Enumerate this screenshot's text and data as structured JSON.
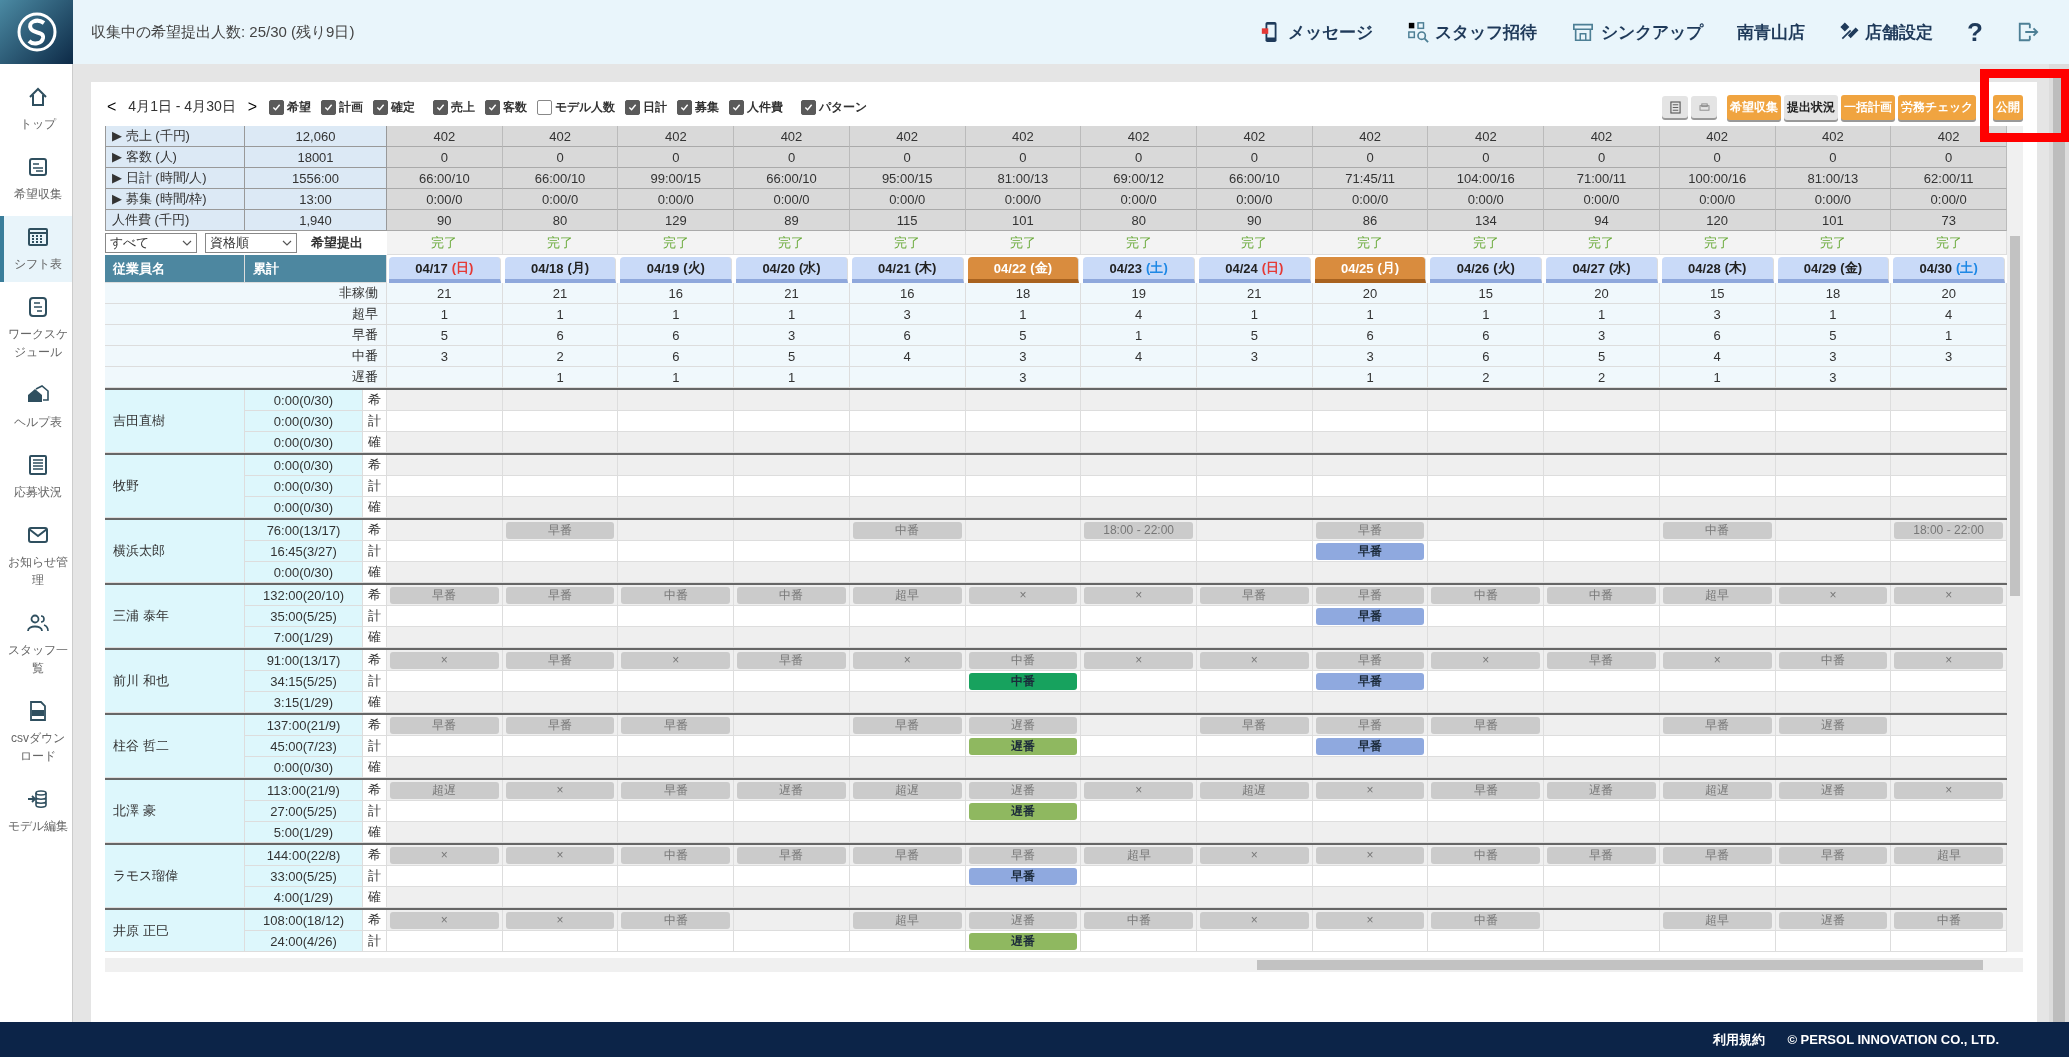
{
  "header": {
    "title": "収集中の希望提出人数: 25/30 (残り9日)",
    "nav": [
      {
        "label": "メッセージ"
      },
      {
        "label": "スタッフ招待"
      },
      {
        "label": "シンクアップ"
      }
    ],
    "store_name": "南青山店",
    "settings_label": "店舗設定",
    "help_label": "?"
  },
  "sidebar": {
    "items": [
      {
        "label": "トップ",
        "selected": false
      },
      {
        "label": "希望収集",
        "selected": false
      },
      {
        "label": "シフト表",
        "selected": true
      },
      {
        "label": "ワークスケジュール",
        "selected": false
      },
      {
        "label": "ヘルプ表",
        "selected": false
      },
      {
        "label": "応募状況",
        "selected": false
      },
      {
        "label": "お知らせ管理",
        "selected": false
      },
      {
        "label": "スタッフ一覧",
        "selected": false
      },
      {
        "label": "csvダウンロード",
        "selected": false
      },
      {
        "label": "モデル編集",
        "selected": false
      }
    ]
  },
  "toolbar": {
    "prev": "<",
    "range": "4月1日 - 4月30日",
    "next": ">",
    "checkboxes": [
      {
        "label": "希望",
        "checked": true
      },
      {
        "label": "計画",
        "checked": true
      },
      {
        "label": "確定",
        "checked": true
      },
      {
        "label": "売上",
        "checked": true
      },
      {
        "label": "客数",
        "checked": true
      },
      {
        "label": "モデル人数",
        "checked": false
      },
      {
        "label": "日計",
        "checked": true
      },
      {
        "label": "募集",
        "checked": true
      },
      {
        "label": "人件費",
        "checked": true
      },
      {
        "label": "パターン",
        "checked": true
      }
    ],
    "buttons": [
      {
        "label": "希望収集",
        "kind": "primary"
      },
      {
        "label": "提出状況",
        "kind": "secondary"
      },
      {
        "label": "一括計画",
        "kind": "primary"
      },
      {
        "label": "労務チェック",
        "kind": "primary"
      },
      {
        "label": "公開",
        "kind": "primary"
      }
    ]
  },
  "summary_rows": [
    {
      "label": "▶ 売上 (千円)",
      "total": "12,060",
      "values": [
        "402",
        "402",
        "402",
        "402",
        "402",
        "402",
        "402",
        "402",
        "402",
        "402",
        "402",
        "402",
        "402",
        "402"
      ]
    },
    {
      "label": "▶ 客数 (人)",
      "total": "18001",
      "values": [
        "0",
        "0",
        "0",
        "0",
        "0",
        "0",
        "0",
        "0",
        "0",
        "0",
        "0",
        "0",
        "0",
        "0"
      ]
    },
    {
      "label": "▶ 日計 (時間/人)",
      "total": "1556:00",
      "values": [
        "66:00/10",
        "66:00/10",
        "99:00/15",
        "66:00/10",
        "95:00/15",
        "81:00/13",
        "69:00/12",
        "66:00/10",
        "71:45/11",
        "104:00/16",
        "71:00/11",
        "100:00/16",
        "81:00/13",
        "62:00/11"
      ]
    },
    {
      "label": "▶ 募集 (時間/枠)",
      "total": "13:00",
      "values": [
        "0:00/0",
        "0:00/0",
        "0:00/0",
        "0:00/0",
        "0:00/0",
        "0:00/0",
        "0:00/0",
        "0:00/0",
        "0:00/0",
        "0:00/0",
        "0:00/0",
        "0:00/0",
        "0:00/0",
        "0:00/0"
      ]
    },
    {
      "label": "人件費 (千円)",
      "total": "1,940",
      "values": [
        "90",
        "80",
        "129",
        "89",
        "115",
        "101",
        "80",
        "90",
        "86",
        "134",
        "94",
        "120",
        "101",
        "73"
      ]
    }
  ],
  "filters": {
    "group": "すべて",
    "order": "資格順",
    "status_label": "希望提出"
  },
  "statuses": [
    "完了",
    "完了",
    "完了",
    "完了",
    "完了",
    "完了",
    "完了",
    "完了",
    "完了",
    "完了",
    "完了",
    "完了",
    "完了",
    "完了"
  ],
  "columns": {
    "name": "従業員名",
    "total": "累計"
  },
  "days": [
    {
      "date": "04/17",
      "weekday": "(日)",
      "color": "#e53935",
      "highlighted": false,
      "counts": [
        "21",
        "1",
        "5",
        "3"
      ]
    },
    {
      "date": "04/18",
      "weekday": "(月)",
      "highlighted": false,
      "counts": [
        "21",
        "1",
        "6",
        "2",
        "1"
      ]
    },
    {
      "date": "04/19",
      "weekday": "(火)",
      "highlighted": false,
      "counts": [
        "16",
        "1",
        "6",
        "6",
        "1"
      ]
    },
    {
      "date": "04/20",
      "weekday": "(水)",
      "highlighted": false,
      "counts": [
        "21",
        "1",
        "3",
        "5",
        "1"
      ]
    },
    {
      "date": "04/21",
      "weekday": "(木)",
      "highlighted": false,
      "counts": [
        "16",
        "3",
        "6",
        "4"
      ]
    },
    {
      "date": "04/22",
      "weekday": "(金)",
      "highlighted": true,
      "counts": [
        "18",
        "1",
        "5",
        "3",
        "3"
      ]
    },
    {
      "date": "04/23",
      "weekday": "(土)",
      "color": "#1e88e5",
      "highlighted": false,
      "counts": [
        "19",
        "4",
        "1",
        "4"
      ]
    },
    {
      "date": "04/24",
      "weekday": "(日)",
      "color": "#e53935",
      "highlighted": false,
      "counts": [
        "21",
        "1",
        "5",
        "3"
      ]
    },
    {
      "date": "04/25",
      "weekday": "(月)",
      "highlighted": true,
      "counts": [
        "20",
        "1",
        "6",
        "3",
        "1"
      ]
    },
    {
      "date": "04/26",
      "weekday": "(火)",
      "highlighted": false,
      "counts": [
        "15",
        "1",
        "6",
        "6",
        "2"
      ]
    },
    {
      "date": "04/27",
      "weekday": "(水)",
      "highlighted": false,
      "counts": [
        "20",
        "1",
        "3",
        "5",
        "2"
      ]
    },
    {
      "date": "04/28",
      "weekday": "(木)",
      "highlighted": false,
      "counts": [
        "15",
        "3",
        "6",
        "4",
        "1"
      ]
    },
    {
      "date": "04/29",
      "weekday": "(金)",
      "highlighted": false,
      "counts": [
        "18",
        "1",
        "5",
        "3",
        "3"
      ]
    },
    {
      "date": "04/30",
      "weekday": "(土)",
      "color": "#1e88e5",
      "highlighted": false,
      "counts": [
        "20",
        "4",
        "1",
        "3"
      ]
    }
  ],
  "count_labels": [
    "非稼働",
    "超早",
    "早番",
    "中番",
    "遅番"
  ],
  "staff": [
    {
      "name": "吉田直樹",
      "rows": [
        {
          "kind": "wish",
          "type": "希",
          "total": "0:00(0/30)",
          "cells": [
            null,
            null,
            null,
            null,
            null,
            null,
            null,
            null,
            null,
            null,
            null,
            null,
            null,
            null
          ]
        },
        {
          "kind": "plan",
          "type": "計",
          "total": "0:00(0/30)",
          "cells": [
            null,
            null,
            null,
            null,
            null,
            null,
            null,
            null,
            null,
            null,
            null,
            null,
            null,
            null
          ]
        },
        {
          "kind": "fixed",
          "type": "確",
          "total": "0:00(0/30)",
          "cells": [
            null,
            null,
            null,
            null,
            null,
            null,
            null,
            null,
            null,
            null,
            null,
            null,
            null,
            null
          ]
        }
      ]
    },
    {
      "name": "牧野",
      "rows": [
        {
          "kind": "wish",
          "type": "希",
          "total": "0:00(0/30)",
          "cells": [
            null,
            null,
            null,
            null,
            null,
            null,
            null,
            null,
            null,
            null,
            null,
            null,
            null,
            null
          ]
        },
        {
          "kind": "plan",
          "type": "計",
          "total": "0:00(0/30)",
          "cells": [
            null,
            null,
            null,
            null,
            null,
            null,
            null,
            null,
            null,
            null,
            null,
            null,
            null,
            null
          ]
        },
        {
          "kind": "fixed",
          "type": "確",
          "total": "0:00(0/30)",
          "cells": [
            null,
            null,
            null,
            null,
            null,
            null,
            null,
            null,
            null,
            null,
            null,
            null,
            null,
            null
          ]
        }
      ]
    },
    {
      "name": "横浜太郎",
      "rows": [
        {
          "kind": "wish",
          "type": "希",
          "total": "76:00(13/17)",
          "cells": [
            null,
            "早番",
            null,
            null,
            "中番",
            null,
            "18:00 - 22:00",
            null,
            "早番",
            null,
            null,
            "中番",
            null,
            "18:00 - 22:00"
          ]
        },
        {
          "kind": "plan",
          "type": "計",
          "total": "16:45(3/27)",
          "cells": [
            null,
            null,
            null,
            null,
            null,
            null,
            null,
            null,
            {
              "text": "早番",
              "color": "#8fa9df"
            },
            null,
            null,
            null,
            null,
            null
          ]
        },
        {
          "kind": "fixed",
          "type": "確",
          "total": "0:00(0/30)",
          "cells": [
            null,
            null,
            null,
            null,
            null,
            null,
            null,
            null,
            null,
            null,
            null,
            null,
            null,
            null
          ]
        }
      ]
    },
    {
      "name": "三浦 泰年",
      "rows": [
        {
          "kind": "wish",
          "type": "希",
          "total": "132:00(20/10)",
          "cells": [
            "早番",
            "早番",
            "中番",
            "中番",
            "超早",
            "×",
            "×",
            "早番",
            "早番",
            "中番",
            "中番",
            "超早",
            "×",
            "×"
          ]
        },
        {
          "kind": "plan",
          "type": "計",
          "total": "35:00(5/25)",
          "cells": [
            null,
            null,
            null,
            null,
            null,
            null,
            null,
            null,
            {
              "text": "早番",
              "color": "#8fa9df"
            },
            null,
            null,
            null,
            null,
            null
          ]
        },
        {
          "kind": "fixed",
          "type": "確",
          "total": "7:00(1/29)",
          "cells": [
            null,
            null,
            null,
            null,
            null,
            null,
            null,
            null,
            null,
            null,
            null,
            null,
            null,
            null
          ]
        }
      ]
    },
    {
      "name": "前川 和也",
      "rows": [
        {
          "kind": "wish",
          "type": "希",
          "total": "91:00(13/17)",
          "cells": [
            "×",
            "早番",
            "×",
            "早番",
            "×",
            "中番",
            "×",
            "×",
            "早番",
            "×",
            "早番",
            "×",
            "中番",
            "×"
          ]
        },
        {
          "kind": "plan",
          "type": "計",
          "total": "34:15(5/25)",
          "cells": [
            null,
            null,
            null,
            null,
            null,
            {
              "text": "中番",
              "color": "#17a25e"
            },
            null,
            null,
            {
              "text": "早番",
              "color": "#8fa9df"
            },
            null,
            null,
            null,
            null,
            null
          ]
        },
        {
          "kind": "fixed",
          "type": "確",
          "total": "3:15(1/29)",
          "cells": [
            null,
            null,
            null,
            null,
            null,
            null,
            null,
            null,
            null,
            null,
            null,
            null,
            null,
            null
          ]
        }
      ]
    },
    {
      "name": "柱谷 哲二",
      "rows": [
        {
          "kind": "wish",
          "type": "希",
          "total": "137:00(21/9)",
          "cells": [
            "早番",
            "早番",
            "早番",
            null,
            "早番",
            "遅番",
            null,
            "早番",
            "早番",
            "早番",
            null,
            "早番",
            "遅番",
            null
          ]
        },
        {
          "kind": "plan",
          "type": "計",
          "total": "45:00(7/23)",
          "cells": [
            null,
            null,
            null,
            null,
            null,
            {
              "text": "遅番",
              "color": "#8fb860"
            },
            null,
            null,
            {
              "text": "早番",
              "color": "#8fa9df"
            },
            null,
            null,
            null,
            null,
            null
          ]
        },
        {
          "kind": "fixed",
          "type": "確",
          "total": "0:00(0/30)",
          "cells": [
            null,
            null,
            null,
            null,
            null,
            null,
            null,
            null,
            null,
            null,
            null,
            null,
            null,
            null
          ]
        }
      ]
    },
    {
      "name": "北澤 豪",
      "rows": [
        {
          "kind": "wish",
          "type": "希",
          "total": "113:00(21/9)",
          "cells": [
            "超遅",
            "×",
            "早番",
            "遅番",
            "超遅",
            "遅番",
            "×",
            "超遅",
            "×",
            "早番",
            "遅番",
            "超遅",
            "遅番",
            "×"
          ]
        },
        {
          "kind": "plan",
          "type": "計",
          "total": "27:00(5/25)",
          "cells": [
            null,
            null,
            null,
            null,
            null,
            {
              "text": "遅番",
              "color": "#8fb860"
            },
            null,
            null,
            null,
            null,
            null,
            null,
            null,
            null
          ]
        },
        {
          "kind": "fixed",
          "type": "確",
          "total": "5:00(1/29)",
          "cells": [
            null,
            null,
            null,
            null,
            null,
            null,
            null,
            null,
            null,
            null,
            null,
            null,
            null,
            null
          ]
        }
      ]
    },
    {
      "name": "ラモス瑠偉",
      "rows": [
        {
          "kind": "wish",
          "type": "希",
          "total": "144:00(22/8)",
          "cells": [
            "×",
            "×",
            "中番",
            "早番",
            "早番",
            "早番",
            "超早",
            "×",
            "×",
            "中番",
            "早番",
            "早番",
            "早番",
            "超早"
          ]
        },
        {
          "kind": "plan",
          "type": "計",
          "total": "33:00(5/25)",
          "cells": [
            null,
            null,
            null,
            null,
            null,
            {
              "text": "早番",
              "color": "#8fa9df"
            },
            null,
            null,
            null,
            null,
            null,
            null,
            null,
            null
          ]
        },
        {
          "kind": "fixed",
          "type": "確",
          "total": "4:00(1/29)",
          "cells": [
            null,
            null,
            null,
            null,
            null,
            null,
            null,
            null,
            null,
            null,
            null,
            null,
            null,
            null
          ]
        }
      ]
    },
    {
      "name": "井原 正巳",
      "rows": [
        {
          "kind": "wish",
          "type": "希",
          "total": "108:00(18/12)",
          "cells": [
            "×",
            "×",
            "中番",
            null,
            "超早",
            "遅番",
            "中番",
            "×",
            "×",
            "中番",
            null,
            "超早",
            "遅番",
            "中番"
          ]
        },
        {
          "kind": "plan",
          "type": "計",
          "total": "24:00(4/26)",
          "cells": [
            null,
            null,
            null,
            null,
            null,
            {
              "text": "遅番",
              "color": "#8fb860"
            },
            null,
            null,
            null,
            null,
            null,
            null,
            null,
            null
          ]
        }
      ]
    }
  ],
  "footer": {
    "terms": "利用規約",
    "copyright": "© PERSOL INNOVATION CO., LTD."
  }
}
